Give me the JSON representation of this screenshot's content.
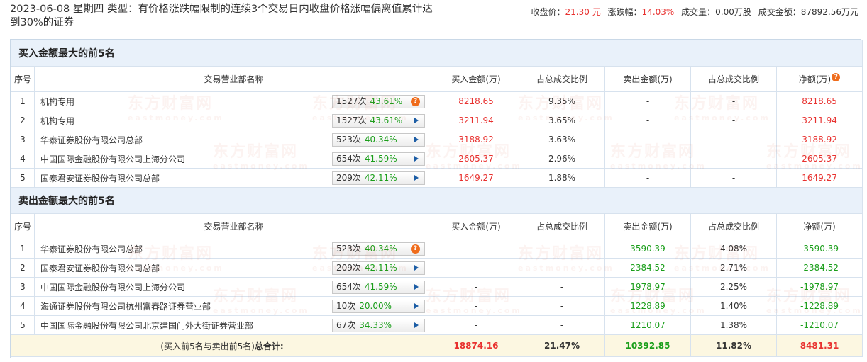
{
  "header": {
    "title": "2023-06-08 星期四 类型：有价格涨跌幅限制的连续3个交易日内收盘价格涨幅偏离值累计达到30%的证券",
    "close_label": "收盘价：",
    "close_value": "21.30 元",
    "change_label": "涨跌幅：",
    "change_value": "14.03%",
    "volume_label": "成交量：",
    "volume_value": "0.00万股",
    "amount_label": "成交金额：",
    "amount_value": "87892.56万元"
  },
  "columns": {
    "idx": "序号",
    "name": "交易营业部名称",
    "buy": "买入金额(万)",
    "buy_ratio": "占总成交比例",
    "sell": "卖出金额(万)",
    "sell_ratio": "占总成交比例",
    "net": "净额(万)"
  },
  "buy_section": {
    "title": "买入金额最大的前5名",
    "rows": [
      {
        "idx": "1",
        "name": "机构专用",
        "times": "1527次",
        "pct": "43.61%",
        "icon": "question-icon",
        "buy": "8218.65",
        "buy_ratio": "9.35%",
        "sell": "-",
        "sell_ratio": "-",
        "net": "8218.65"
      },
      {
        "idx": "2",
        "name": "机构专用",
        "times": "1527次",
        "pct": "43.61%",
        "icon": "arrow-right-icon",
        "buy": "3211.94",
        "buy_ratio": "3.65%",
        "sell": "-",
        "sell_ratio": "-",
        "net": "3211.94"
      },
      {
        "idx": "3",
        "name": "华泰证券股份有限公司总部",
        "times": "523次",
        "pct": "40.34%",
        "icon": "arrow-right-icon",
        "buy": "3188.92",
        "buy_ratio": "3.63%",
        "sell": "-",
        "sell_ratio": "-",
        "net": "3188.92"
      },
      {
        "idx": "4",
        "name": "中国国际金融股份有限公司上海分公司",
        "times": "654次",
        "pct": "41.59%",
        "icon": "arrow-right-icon",
        "buy": "2605.37",
        "buy_ratio": "2.96%",
        "sell": "-",
        "sell_ratio": "-",
        "net": "2605.37"
      },
      {
        "idx": "5",
        "name": "国泰君安证券股份有限公司总部",
        "times": "209次",
        "pct": "42.11%",
        "icon": "arrow-right-icon",
        "buy": "1649.27",
        "buy_ratio": "1.88%",
        "sell": "-",
        "sell_ratio": "-",
        "net": "1649.27"
      }
    ]
  },
  "sell_section": {
    "title": "卖出金额最大的前5名",
    "rows": [
      {
        "idx": "1",
        "name": "华泰证券股份有限公司总部",
        "times": "523次",
        "pct": "40.34%",
        "icon": "question-icon",
        "buy": "-",
        "buy_ratio": "-",
        "sell": "3590.39",
        "sell_ratio": "4.08%",
        "net": "-3590.39"
      },
      {
        "idx": "2",
        "name": "国泰君安证券股份有限公司总部",
        "times": "209次",
        "pct": "42.11%",
        "icon": "arrow-right-icon",
        "buy": "-",
        "buy_ratio": "-",
        "sell": "2384.52",
        "sell_ratio": "2.71%",
        "net": "-2384.52"
      },
      {
        "idx": "3",
        "name": "中国国际金融股份有限公司上海分公司",
        "times": "654次",
        "pct": "41.59%",
        "icon": "arrow-right-icon",
        "buy": "-",
        "buy_ratio": "-",
        "sell": "1978.97",
        "sell_ratio": "2.25%",
        "net": "-1978.97"
      },
      {
        "idx": "4",
        "name": "海通证券股份有限公司杭州富春路证券营业部",
        "times": "10次",
        "pct": "20.00%",
        "icon": "arrow-right-icon",
        "buy": "-",
        "buy_ratio": "-",
        "sell": "1228.89",
        "sell_ratio": "1.40%",
        "net": "-1228.89"
      },
      {
        "idx": "5",
        "name": "中国国际金融股份有限公司北京建国门外大街证券营业部",
        "times": "67次",
        "pct": "34.33%",
        "icon": "arrow-right-icon",
        "buy": "-",
        "buy_ratio": "-",
        "sell": "1210.07",
        "sell_ratio": "1.38%",
        "net": "-1210.07"
      }
    ]
  },
  "total": {
    "label_prefix": "(买入前5名与卖出前5名)",
    "label_bold": "总合计:",
    "buy": "18874.16",
    "buy_ratio": "21.47%",
    "sell": "10392.85",
    "sell_ratio": "11.82%",
    "net": "8481.31"
  },
  "watermark": {
    "cn": "东方财富网",
    "en": "eastmoney.com"
  },
  "colors": {
    "up": "#e8312f",
    "down": "#1a9e1a",
    "header_bg": "#e9f1fa",
    "total_bg": "#fcf7e1",
    "icon_orange": "#ef6c1c",
    "arrow_blue": "#1c5da5"
  }
}
